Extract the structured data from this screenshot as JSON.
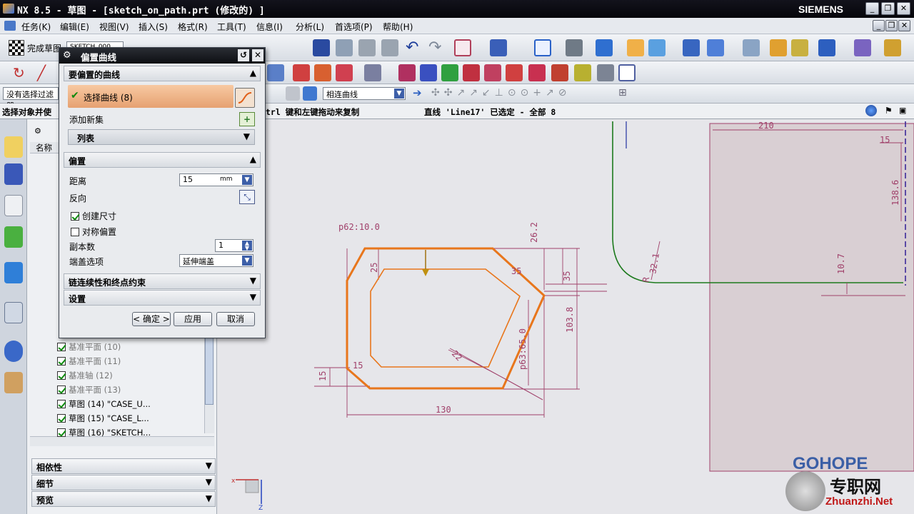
{
  "window": {
    "title": "NX 8.5 - 草图 - [sketch_on_path.prt (修改的) ]",
    "brand": "SIEMENS"
  },
  "menu": [
    "任务(K)",
    "编辑(E)",
    "视图(V)",
    "插入(S)",
    "格式(R)",
    "工具(T)",
    "信息(I)",
    "分析(L)",
    "首选项(P)",
    "帮助(H)"
  ],
  "toolbar": {
    "finish_sketch": "完成草图",
    "sketch_name": "SKETCH_000",
    "filter": "没有选择过滤器",
    "curve_rule": "相连曲线"
  },
  "status": {
    "left": "选择对象并使",
    "middle": "trl 键和左键拖动来复制",
    "right": "直线 'Line17' 已选定 - 全部 8"
  },
  "nav": {
    "header_col": "名称",
    "rows": [
      {
        "label": "基准平面 (10)",
        "checked": true
      },
      {
        "label": "基准平面 (11)",
        "checked": true
      },
      {
        "label": "基准轴 (12)",
        "checked": true
      },
      {
        "label": "基准平面 (13)",
        "checked": true
      },
      {
        "label": "草图 (14) \"CASE_U...",
        "checked": true
      },
      {
        "label": "草图 (15) \"CASE_L...",
        "checked": true
      },
      {
        "label": "草图 (16) \"SKETCH...",
        "checked": true
      }
    ],
    "panels": [
      "相依性",
      "细节",
      "预览"
    ]
  },
  "dialog": {
    "title": "偏置曲线",
    "sect_curves": "要偏置的曲线",
    "select_curve": "选择曲线 (8)",
    "add_set": "添加新集",
    "list": "列表",
    "sect_offset": "偏置",
    "distance_label": "距离",
    "distance_value": "15",
    "distance_unit": "mm",
    "reverse": "反向",
    "create_dim": "创建尺寸",
    "create_dim_checked": true,
    "symmetric": "对称偏置",
    "symmetric_checked": false,
    "copies_label": "副本数",
    "copies_value": "1",
    "cap_label": "端盖选项",
    "cap_value": "延伸端盖",
    "sect_chain": "链连续性和终点约束",
    "sect_settings": "设置",
    "ok": "< 确定 >",
    "apply": "应用",
    "cancel": "取消"
  },
  "sketch": {
    "dims": [
      "p62:10.0",
      "26.2",
      "25",
      "35",
      "35",
      "103.8",
      "p63:65.0",
      "22",
      "15",
      "15",
      "130",
      "210",
      "15",
      "138.6",
      "32.1",
      "10.7"
    ],
    "dim_prefix": "R"
  },
  "watermark": {
    "brand": "GOHOPE",
    "site_cn": "专职网",
    "site": "Zhuanzhi.Net"
  },
  "colors": {
    "selected_curve": "#e8761c",
    "dimension": "#a0406a",
    "green_curve": "#1d7a1d",
    "accent": "#e79a5a"
  }
}
